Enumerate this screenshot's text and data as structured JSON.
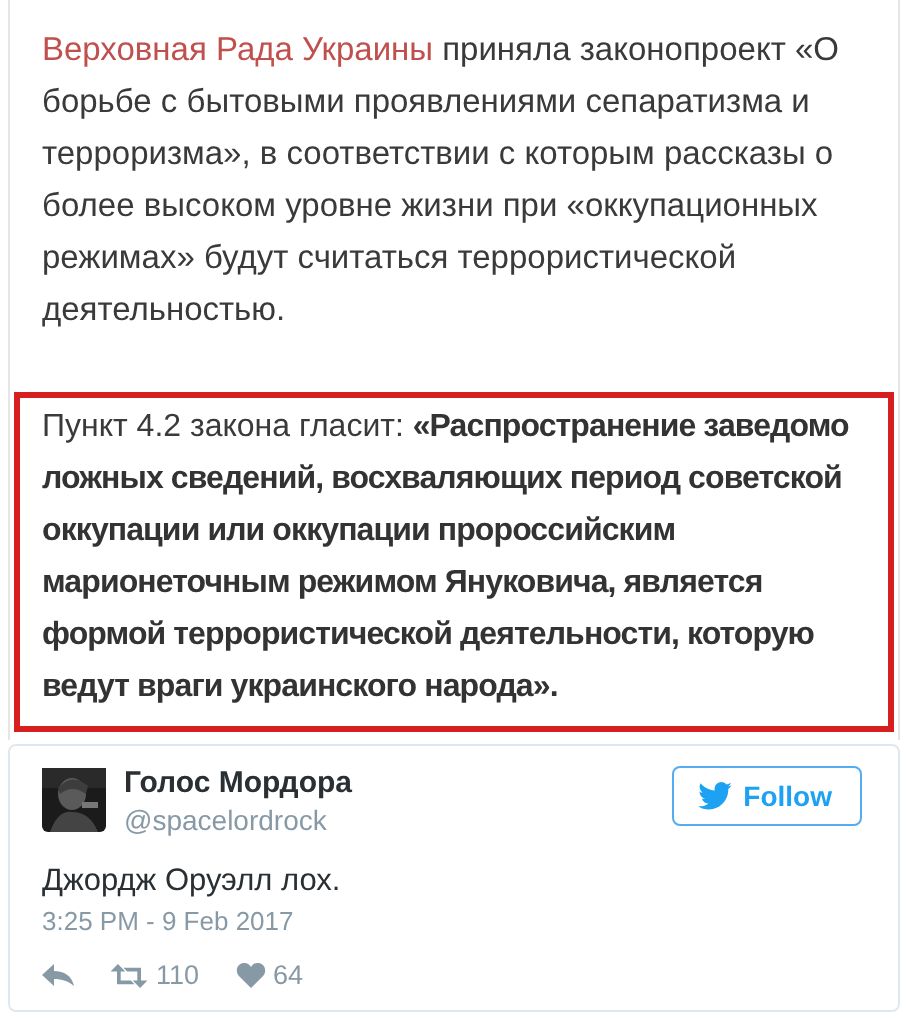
{
  "article": {
    "intro_link": "Верховная Рада Украины",
    "intro_text": "приняла законопроект «О борьбе с бытовыми проявлениями сепаратизма и терроризма», в соответствии с которым рассказы о более высоком уровне жизни при «оккупационных режимах» будут считаться террористической деятельностью."
  },
  "quote": {
    "text": "Пункт 4.2 закона гласит: **«Распространение заведомо ложных сведений, восхваляющих период советской оккупации или оккупации пророссийским марионеточным режимом Януковича, является формой террористической деятельности, которую ведут враги украинского народа».**"
  },
  "tweet": {
    "author": "Голос Мордора",
    "handle": "@spacelordrock",
    "follow_label": "Follow",
    "text": "Джордж Оруэлл лох.",
    "timestamp": "3:25 PM - 9 Feb 2017",
    "retweets": "110",
    "likes": "64"
  }
}
